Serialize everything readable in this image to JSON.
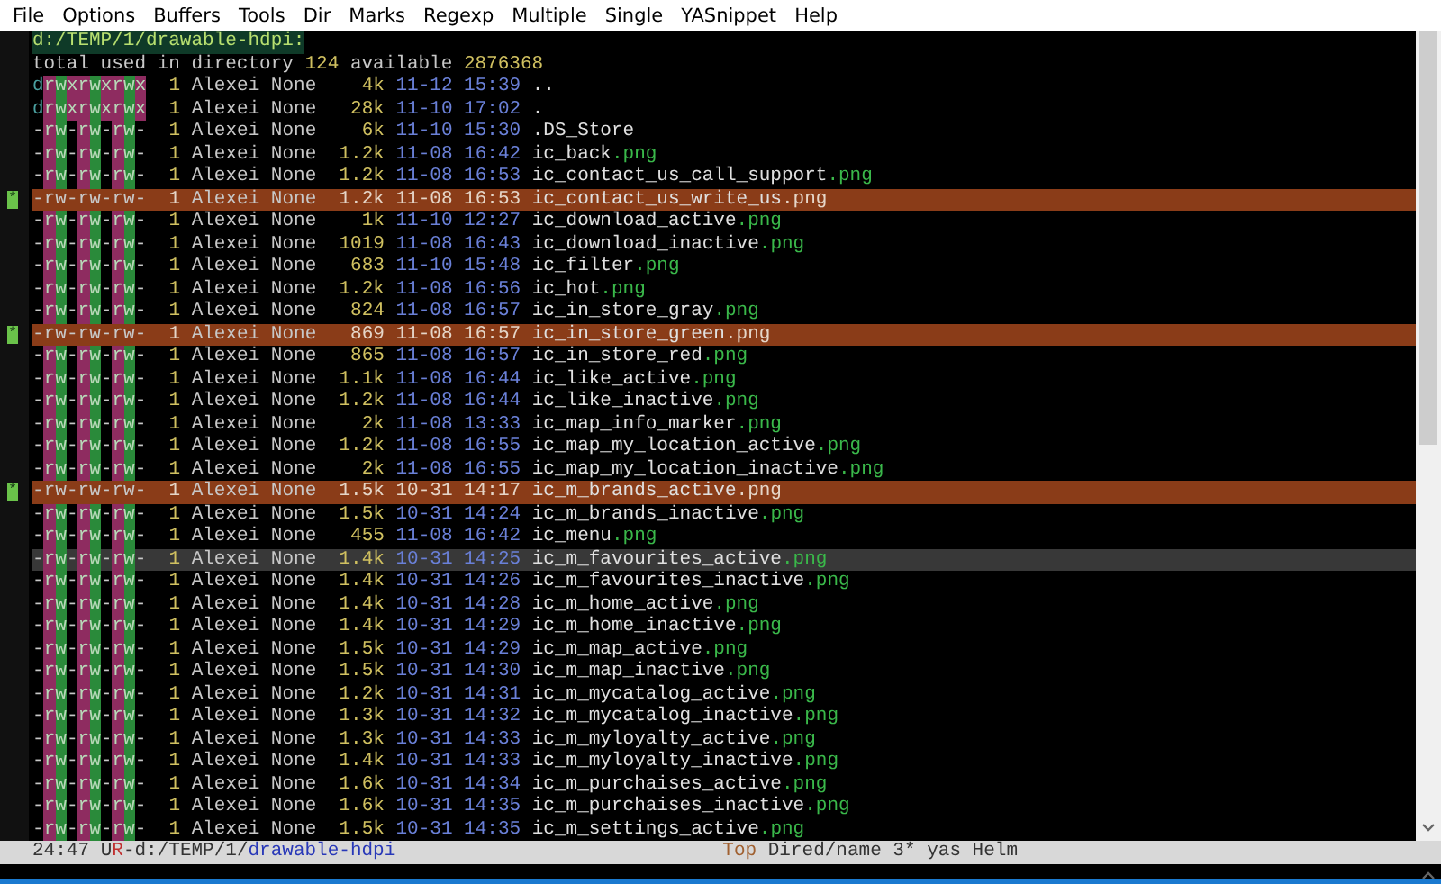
{
  "menu_bar": [
    "File",
    "Options",
    "Buffers",
    "Tools",
    "Dir",
    "Marks",
    "Regexp",
    "Multiple",
    "Single",
    "YASnippet",
    "Help"
  ],
  "header": {
    "path": "d:/TEMP/1/drawable-hdpi:",
    "total_label": "total used in directory",
    "total": "124",
    "available_label": "available",
    "available": "2876368"
  },
  "rows": [
    {
      "perms": "drwxrwxrwx",
      "links": "1",
      "owner": "Alexei None",
      "size": "4k",
      "date": "11-12",
      "time": "15:39",
      "name": "..",
      "ext": "",
      "marked": false,
      "current": false
    },
    {
      "perms": "drwxrwxrwx",
      "links": "1",
      "owner": "Alexei None",
      "size": "28k",
      "date": "11-10",
      "time": "17:02",
      "name": ".",
      "ext": "",
      "marked": false,
      "current": false
    },
    {
      "perms": "-rw-rw-rw-",
      "links": "1",
      "owner": "Alexei None",
      "size": "6k",
      "date": "11-10",
      "time": "15:30",
      "name": ".DS_Store",
      "ext": "",
      "marked": false,
      "current": false
    },
    {
      "perms": "-rw-rw-rw-",
      "links": "1",
      "owner": "Alexei None",
      "size": "1.2k",
      "date": "11-08",
      "time": "16:42",
      "name": "ic_back",
      "ext": ".png",
      "marked": false,
      "current": false
    },
    {
      "perms": "-rw-rw-rw-",
      "links": "1",
      "owner": "Alexei None",
      "size": "1.2k",
      "date": "11-08",
      "time": "16:53",
      "name": "ic_contact_us_call_support",
      "ext": ".png",
      "marked": false,
      "current": false
    },
    {
      "perms": "-rw-rw-rw-",
      "links": "1",
      "owner": "Alexei None",
      "size": "1.2k",
      "date": "11-08",
      "time": "16:53",
      "name": "ic_contact_us_write_us",
      "ext": ".png",
      "marked": true,
      "mark_char": "*",
      "current": false
    },
    {
      "perms": "-rw-rw-rw-",
      "links": "1",
      "owner": "Alexei None",
      "size": "1k",
      "date": "11-10",
      "time": "12:27",
      "name": "ic_download_active",
      "ext": ".png",
      "marked": false,
      "current": false
    },
    {
      "perms": "-rw-rw-rw-",
      "links": "1",
      "owner": "Alexei None",
      "size": "1019",
      "date": "11-08",
      "time": "16:43",
      "name": "ic_download_inactive",
      "ext": ".png",
      "marked": false,
      "current": false
    },
    {
      "perms": "-rw-rw-rw-",
      "links": "1",
      "owner": "Alexei None",
      "size": "683",
      "date": "11-10",
      "time": "15:48",
      "name": "ic_filter",
      "ext": ".png",
      "marked": false,
      "current": false
    },
    {
      "perms": "-rw-rw-rw-",
      "links": "1",
      "owner": "Alexei None",
      "size": "1.2k",
      "date": "11-08",
      "time": "16:56",
      "name": "ic_hot",
      "ext": ".png",
      "marked": false,
      "current": false
    },
    {
      "perms": "-rw-rw-rw-",
      "links": "1",
      "owner": "Alexei None",
      "size": "824",
      "date": "11-08",
      "time": "16:57",
      "name": "ic_in_store_gray",
      "ext": ".png",
      "marked": false,
      "current": false
    },
    {
      "perms": "-rw-rw-rw-",
      "links": "1",
      "owner": "Alexei None",
      "size": "869",
      "date": "11-08",
      "time": "16:57",
      "name": "ic_in_store_green",
      "ext": ".png",
      "marked": true,
      "mark_char": "*",
      "current": false
    },
    {
      "perms": "-rw-rw-rw-",
      "links": "1",
      "owner": "Alexei None",
      "size": "865",
      "date": "11-08",
      "time": "16:57",
      "name": "ic_in_store_red",
      "ext": ".png",
      "marked": false,
      "current": false
    },
    {
      "perms": "-rw-rw-rw-",
      "links": "1",
      "owner": "Alexei None",
      "size": "1.1k",
      "date": "11-08",
      "time": "16:44",
      "name": "ic_like_active",
      "ext": ".png",
      "marked": false,
      "current": false
    },
    {
      "perms": "-rw-rw-rw-",
      "links": "1",
      "owner": "Alexei None",
      "size": "1.2k",
      "date": "11-08",
      "time": "16:44",
      "name": "ic_like_inactive",
      "ext": ".png",
      "marked": false,
      "current": false
    },
    {
      "perms": "-rw-rw-rw-",
      "links": "1",
      "owner": "Alexei None",
      "size": "2k",
      "date": "11-08",
      "time": "13:33",
      "name": "ic_map_info_marker",
      "ext": ".png",
      "marked": false,
      "current": false
    },
    {
      "perms": "-rw-rw-rw-",
      "links": "1",
      "owner": "Alexei None",
      "size": "1.2k",
      "date": "11-08",
      "time": "16:55",
      "name": "ic_map_my_location_active",
      "ext": ".png",
      "marked": false,
      "current": false
    },
    {
      "perms": "-rw-rw-rw-",
      "links": "1",
      "owner": "Alexei None",
      "size": "2k",
      "date": "11-08",
      "time": "16:55",
      "name": "ic_map_my_location_inactive",
      "ext": ".png",
      "marked": false,
      "current": false
    },
    {
      "perms": "-rw-rw-rw-",
      "links": "1",
      "owner": "Alexei None",
      "size": "1.5k",
      "date": "10-31",
      "time": "14:17",
      "name": "ic_m_brands_active",
      "ext": ".png",
      "marked": true,
      "mark_char": "*",
      "current": false
    },
    {
      "perms": "-rw-rw-rw-",
      "links": "1",
      "owner": "Alexei None",
      "size": "1.5k",
      "date": "10-31",
      "time": "14:24",
      "name": "ic_m_brands_inactive",
      "ext": ".png",
      "marked": false,
      "current": false
    },
    {
      "perms": "-rw-rw-rw-",
      "links": "1",
      "owner": "Alexei None",
      "size": "455",
      "date": "11-08",
      "time": "16:42",
      "name": "ic_menu",
      "ext": ".png",
      "marked": false,
      "current": false
    },
    {
      "perms": "-rw-rw-rw-",
      "links": "1",
      "owner": "Alexei None",
      "size": "1.4k",
      "date": "10-31",
      "time": "14:25",
      "name": "ic_m_favourites_active",
      "ext": ".png",
      "marked": false,
      "current": true
    },
    {
      "perms": "-rw-rw-rw-",
      "links": "1",
      "owner": "Alexei None",
      "size": "1.4k",
      "date": "10-31",
      "time": "14:26",
      "name": "ic_m_favourites_inactive",
      "ext": ".png",
      "marked": false,
      "current": false
    },
    {
      "perms": "-rw-rw-rw-",
      "links": "1",
      "owner": "Alexei None",
      "size": "1.4k",
      "date": "10-31",
      "time": "14:28",
      "name": "ic_m_home_active",
      "ext": ".png",
      "marked": false,
      "current": false
    },
    {
      "perms": "-rw-rw-rw-",
      "links": "1",
      "owner": "Alexei None",
      "size": "1.4k",
      "date": "10-31",
      "time": "14:29",
      "name": "ic_m_home_inactive",
      "ext": ".png",
      "marked": false,
      "current": false
    },
    {
      "perms": "-rw-rw-rw-",
      "links": "1",
      "owner": "Alexei None",
      "size": "1.5k",
      "date": "10-31",
      "time": "14:29",
      "name": "ic_m_map_active",
      "ext": ".png",
      "marked": false,
      "current": false
    },
    {
      "perms": "-rw-rw-rw-",
      "links": "1",
      "owner": "Alexei None",
      "size": "1.5k",
      "date": "10-31",
      "time": "14:30",
      "name": "ic_m_map_inactive",
      "ext": ".png",
      "marked": false,
      "current": false
    },
    {
      "perms": "-rw-rw-rw-",
      "links": "1",
      "owner": "Alexei None",
      "size": "1.2k",
      "date": "10-31",
      "time": "14:31",
      "name": "ic_m_mycatalog_active",
      "ext": ".png",
      "marked": false,
      "current": false
    },
    {
      "perms": "-rw-rw-rw-",
      "links": "1",
      "owner": "Alexei None",
      "size": "1.3k",
      "date": "10-31",
      "time": "14:32",
      "name": "ic_m_mycatalog_inactive",
      "ext": ".png",
      "marked": false,
      "current": false
    },
    {
      "perms": "-rw-rw-rw-",
      "links": "1",
      "owner": "Alexei None",
      "size": "1.3k",
      "date": "10-31",
      "time": "14:33",
      "name": "ic_m_myloyalty_active",
      "ext": ".png",
      "marked": false,
      "current": false
    },
    {
      "perms": "-rw-rw-rw-",
      "links": "1",
      "owner": "Alexei None",
      "size": "1.4k",
      "date": "10-31",
      "time": "14:33",
      "name": "ic_m_myloyalty_inactive",
      "ext": ".png",
      "marked": false,
      "current": false
    },
    {
      "perms": "-rw-rw-rw-",
      "links": "1",
      "owner": "Alexei None",
      "size": "1.6k",
      "date": "10-31",
      "time": "14:34",
      "name": "ic_m_purchaises_active",
      "ext": ".png",
      "marked": false,
      "current": false
    },
    {
      "perms": "-rw-rw-rw-",
      "links": "1",
      "owner": "Alexei None",
      "size": "1.6k",
      "date": "10-31",
      "time": "14:35",
      "name": "ic_m_purchaises_inactive",
      "ext": ".png",
      "marked": false,
      "current": false
    },
    {
      "perms": "-rw-rw-rw-",
      "links": "1",
      "owner": "Alexei None",
      "size": "1.5k",
      "date": "10-31",
      "time": "14:35",
      "name": "ic_m_settings_active",
      "ext": ".png",
      "marked": false,
      "current": false
    }
  ],
  "mode_line": {
    "position": "24:47",
    "flags": [
      {
        "text": "U",
        "color": "#333333"
      },
      {
        "text": "R",
        "color": "#c03030"
      }
    ],
    "path": "-d:/TEMP/1/",
    "buffer": "drawable-hdpi",
    "scroll": "Top",
    "modes": "Dired/name 3* yas Helm"
  }
}
